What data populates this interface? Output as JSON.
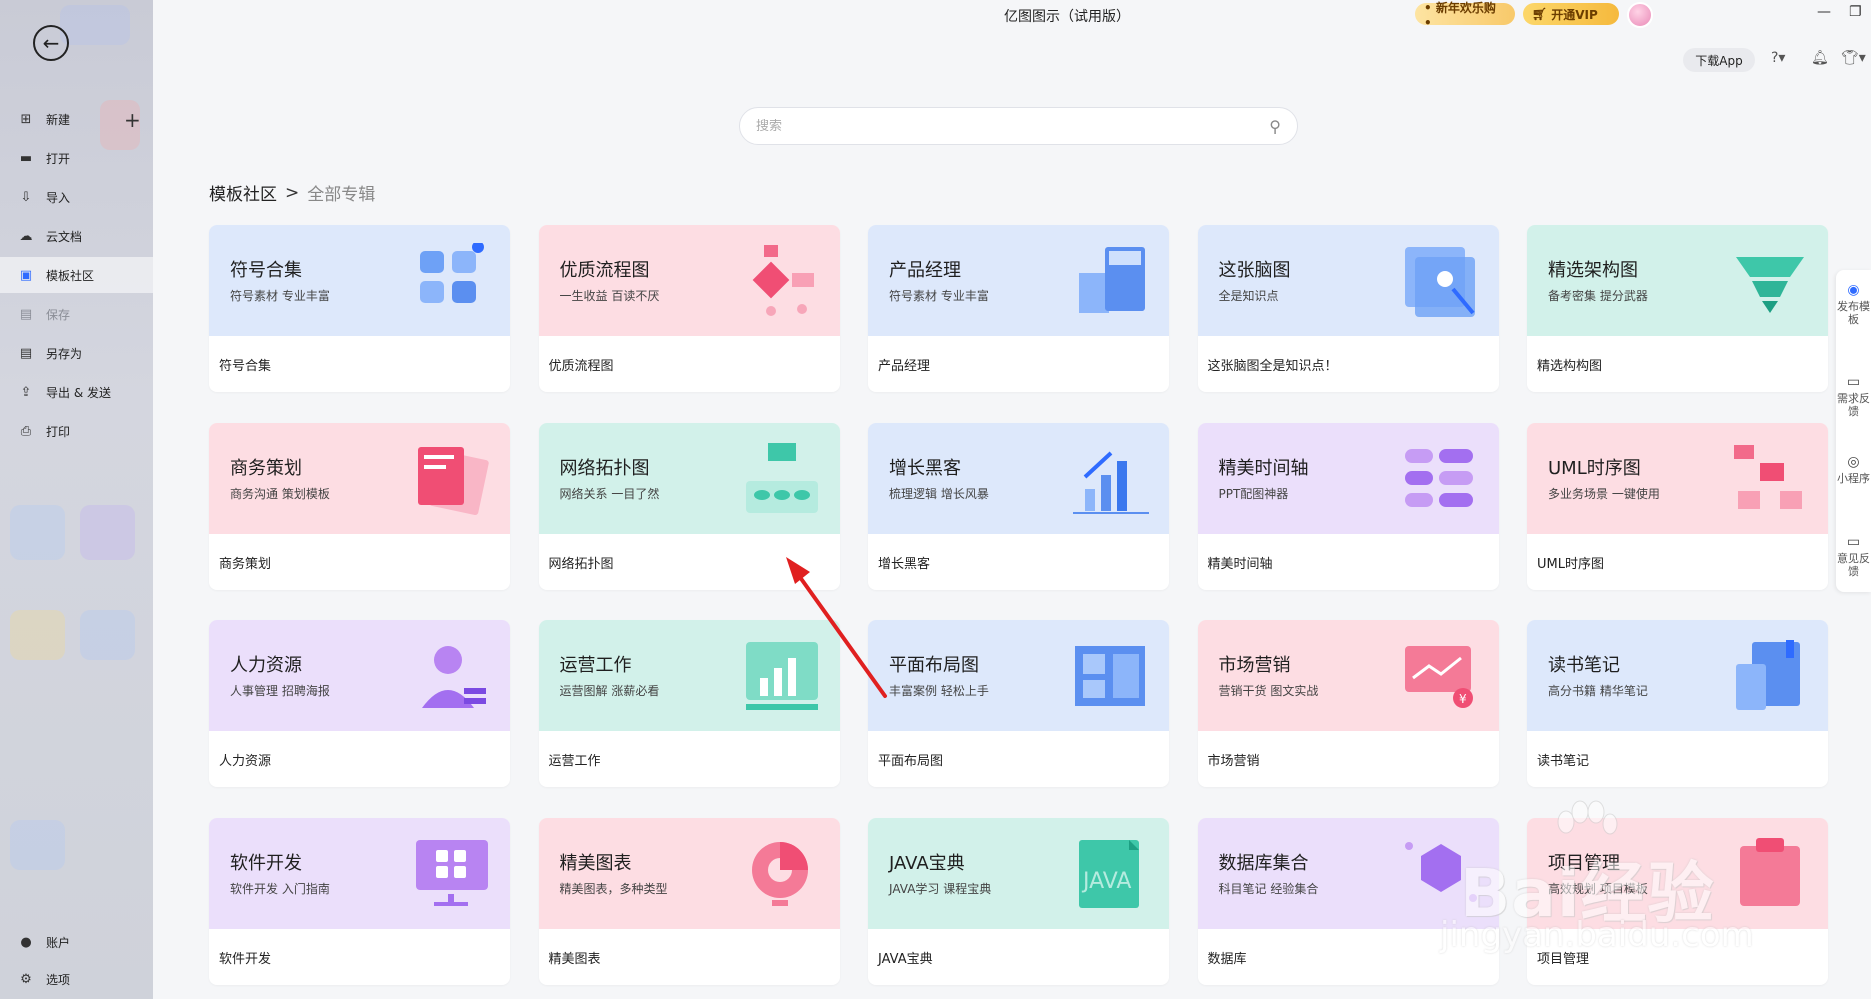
{
  "titlebar": {
    "app_title": "亿图图示（试用版）",
    "promo_new_year": "• 新年欢乐购 •",
    "promo_vip": "开通VIP",
    "download_app": "下载App"
  },
  "sidebar": {
    "items": [
      {
        "label": "新建",
        "icon": "plus-square-icon"
      },
      {
        "label": "打开",
        "icon": "folder-icon"
      },
      {
        "label": "导入",
        "icon": "import-icon"
      },
      {
        "label": "云文档",
        "icon": "cloud-icon"
      },
      {
        "label": "模板社区",
        "icon": "community-icon"
      },
      {
        "label": "保存",
        "icon": "save-icon"
      },
      {
        "label": "另存为",
        "icon": "save-as-icon"
      },
      {
        "label": "导出 & 发送",
        "icon": "export-icon"
      },
      {
        "label": "打印",
        "icon": "print-icon"
      }
    ],
    "bottom": [
      {
        "label": "账户",
        "icon": "account-icon"
      },
      {
        "label": "选项",
        "icon": "gear-icon"
      }
    ]
  },
  "search": {
    "placeholder": "搜索"
  },
  "breadcrumb": {
    "root": "模板社区",
    "sep": ">",
    "current": "全部专辑"
  },
  "cards": [
    {
      "title": "符号合集",
      "sub": "符号素材 专业丰富",
      "name": "符号合集",
      "color": "blue"
    },
    {
      "title": "优质流程图",
      "sub": "一生收益 百读不厌",
      "name": "优质流程图",
      "color": "pink"
    },
    {
      "title": "产品经理",
      "sub": "符号素材 专业丰富",
      "name": "产品经理",
      "color": "blue"
    },
    {
      "title": "这张脑图",
      "sub": "全是知识点",
      "name": "这张脑图全是知识点！",
      "color": "blue"
    },
    {
      "title": "精选架构图",
      "sub": "备考密集 提分武器",
      "name": "精选构构图",
      "color": "mint"
    },
    {
      "title": "商务策划",
      "sub": "商务沟通 策划模板",
      "name": "商务策划",
      "color": "pink"
    },
    {
      "title": "网络拓扑图",
      "sub": "网络关系 一目了然",
      "name": "网络拓扑图",
      "color": "mint"
    },
    {
      "title": "增长黑客",
      "sub": "梳理逻辑 增长风暴",
      "name": "增长黑客",
      "color": "blue"
    },
    {
      "title": "精美时间轴",
      "sub": "PPT配图神器",
      "name": "精美时间轴",
      "color": "purple"
    },
    {
      "title": "UML时序图",
      "sub": "多业务场景 一键使用",
      "name": "UML时序图",
      "color": "pink"
    },
    {
      "title": "人力资源",
      "sub": "人事管理 招聘海报",
      "name": "人力资源",
      "color": "purple"
    },
    {
      "title": "运营工作",
      "sub": "运营图解 涨薪必看",
      "name": "运营工作",
      "color": "mint"
    },
    {
      "title": "平面布局图",
      "sub": "丰富案例 轻松上手",
      "name": "平面布局图",
      "color": "blue"
    },
    {
      "title": "市场营销",
      "sub": "营销干货 图文实战",
      "name": "市场营销",
      "color": "pink"
    },
    {
      "title": "读书笔记",
      "sub": "高分书籍 精华笔记",
      "name": "读书笔记",
      "color": "blue"
    },
    {
      "title": "软件开发",
      "sub": "软件开发 入门指南",
      "name": "软件开发",
      "color": "purple"
    },
    {
      "title": "精美图表",
      "sub": "精美图表，多种类型",
      "name": "精美图表",
      "color": "pink"
    },
    {
      "title": "JAVA宝典",
      "sub": "JAVA学习 课程宝典",
      "name": "JAVA宝典",
      "color": "mint"
    },
    {
      "title": "数据库集合",
      "sub": "科目笔记 经验集合",
      "name": "数据库",
      "color": "purple"
    },
    {
      "title": "项目管理",
      "sub": "高效规划 项目模板",
      "name": "项目管理",
      "color": "pink"
    }
  ],
  "float_panel": [
    {
      "label": "发布模板",
      "icon": "publish-icon"
    },
    {
      "label": "需求反馈",
      "icon": "request-icon"
    },
    {
      "label": "小程序",
      "icon": "miniprogram-icon"
    },
    {
      "label": "意见反馈",
      "icon": "feedback-icon"
    }
  ],
  "watermark": {
    "brand": "Bai经验",
    "url": "jingyan.baidu.com"
  },
  "colors": {
    "blue": "#dde8fb",
    "pink": "#fddde3",
    "mint": "#d2f1ea",
    "purple": "#ebdffb",
    "accent": "#2f6bff",
    "arrow": "#e02020"
  }
}
